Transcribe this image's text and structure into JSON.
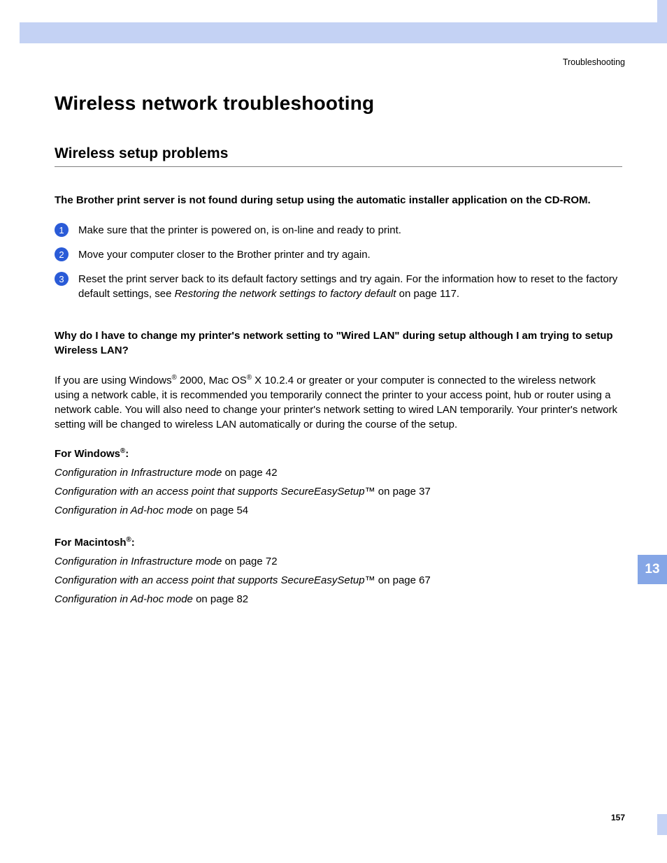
{
  "header": {
    "section": "Troubleshooting"
  },
  "title": "Wireless network troubleshooting",
  "subtitle": "Wireless setup problems",
  "problem1": {
    "heading": "The Brother print server is not found during setup using the automatic installer application on the CD-ROM.",
    "steps": {
      "s1": {
        "n": "1",
        "text": "Make sure that the printer is powered on, is on-line and ready to print."
      },
      "s2": {
        "n": "2",
        "text": "Move your computer closer to the Brother printer and try again."
      },
      "s3": {
        "n": "3",
        "pre": "Reset the print server back to its default factory settings and try again. For the information how to reset to the factory default settings, see ",
        "ref": "Restoring the network settings to factory default",
        "post": " on page 117."
      }
    }
  },
  "problem2": {
    "heading": "Why do I have to change my printer's network setting to \"Wired LAN\" during setup although I am trying to setup Wireless LAN?",
    "para_pre": "If you are using Windows",
    "para_mid1": " 2000, Mac OS",
    "para_mid2": " X 10.2.4 or greater or your computer is connected to the wireless network using a network cable, it is recommended you temporarily connect the printer to your access point, hub or router using a network cable. You will also need to change your printer's network setting to wired LAN temporarily. Your printer's network setting will be changed to wireless LAN automatically or during the course of the setup."
  },
  "windows": {
    "label_pre": "For Windows",
    "label_post": ":",
    "r1": {
      "title": "Configuration in Infrastructure mode",
      "loc": " on page 42"
    },
    "r2": {
      "title": "Configuration with an access point that supports SecureEasySetup™",
      "loc": " on page 37"
    },
    "r3": {
      "title": "Configuration in Ad-hoc mode",
      "loc": " on page 54"
    }
  },
  "mac": {
    "label_pre": "For Macintosh",
    "label_post": ":",
    "r1": {
      "title": "Configuration in Infrastructure mode",
      "loc": " on page 72"
    },
    "r2": {
      "title": "Configuration with an access point that supports SecureEasySetup™",
      "loc": " on page 67"
    },
    "r3": {
      "title": "Configuration in Ad-hoc mode",
      "loc": " on page 82"
    }
  },
  "chapter": "13",
  "page": "157",
  "reg": "®"
}
